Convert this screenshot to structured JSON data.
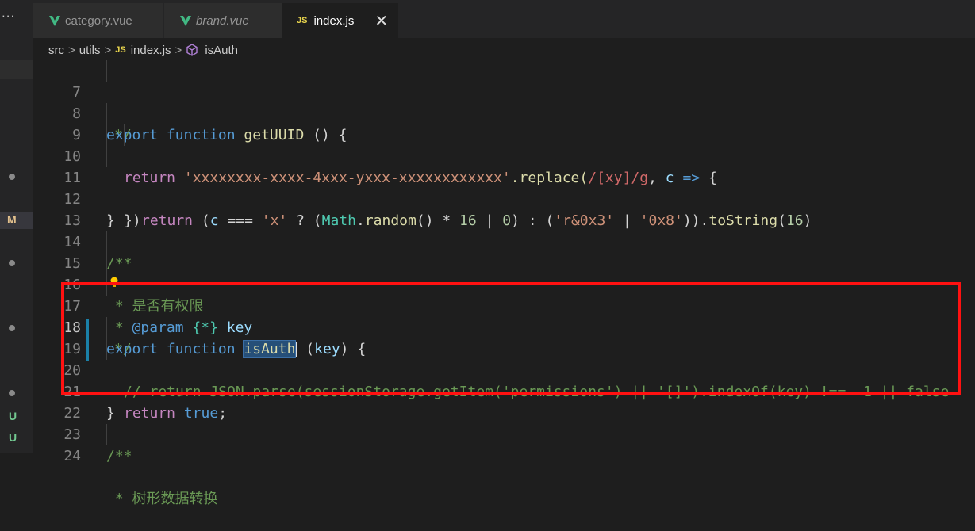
{
  "sidebar": {
    "more": "···",
    "markers": [
      {
        "text": "M",
        "color": "#e2c08d"
      },
      {
        "text": "U",
        "color": "#73c991"
      },
      {
        "text": "U",
        "color": "#73c991"
      }
    ]
  },
  "tabs": [
    {
      "label": "category.vue",
      "icon": "vue-icon",
      "active": false
    },
    {
      "label": "brand.vue",
      "icon": "vue-icon",
      "active": false
    },
    {
      "label": "index.js",
      "icon": "js-icon",
      "active": true
    }
  ],
  "tab_close": "✕",
  "js_badge": "JS",
  "breadcrumb": {
    "parts": [
      "src",
      "utils",
      "index.js",
      "isAuth"
    ],
    "sep": ">"
  },
  "code": {
    "l7": "*/",
    "l8_export": "export",
    "l8_function": "function",
    "l8_name": "getUUID",
    "l8_rest": " () {",
    "l9_return": "return",
    "l9_str": "'xxxxxxxx-xxxx-4xxx-yxxx-xxxxxxxxxxxx'",
    "l9_replace": ".replace(",
    "l9_regex": "/[xy]/g",
    "l9_comma": ", ",
    "l9_c": "c",
    "l9_arrow": "=>",
    "l9_end": " {",
    "l10_return": "return",
    "l10_p1": " (",
    "l10_c": "c",
    "l10_op": " === ",
    "l10_x": "'x'",
    "l10_q": " ? (",
    "l10_math": "Math",
    "l10_dot": ".",
    "l10_random": "random",
    "l10_p2": "() * ",
    "l10_16a": "16",
    "l10_or": " | ",
    "l10_0": "0",
    "l10_p3": ") : (",
    "l10_r": "'r&0x3'",
    "l10_or2": " | ",
    "l10_08": "'0x8'",
    "l10_p4": ")).",
    "l10_tostring": "toString",
    "l10_p5": "(",
    "l10_16b": "16",
    "l10_p6": ")",
    "l11": "})",
    "l12": "}",
    "l14": "/**",
    "l15": " * 是否有权限",
    "l16_star": " * ",
    "l16_param": "@param",
    "l16_type": "{*}",
    "l16_key": "key",
    "l17": "*/",
    "l18_export": "export",
    "l18_function": "function",
    "l18_name": "isAuth",
    "l18_p1": " (",
    "l18_key": "key",
    "l18_p2": ") {",
    "l19": "// return JSON.parse(sessionStorage.getItem('permissions') || '[]').indexOf(key) !== -1 || false",
    "l20_return": "return",
    "l20_true": "true",
    "l20_semi": ";",
    "l21": "}",
    "l23": "/**",
    "l24": " * 树形数据转换"
  },
  "line_numbers": [
    "7",
    "8",
    "9",
    "10",
    "11",
    "12",
    "13",
    "14",
    "15",
    "16",
    "17",
    "18",
    "19",
    "20",
    "21",
    "22",
    "23",
    "24"
  ]
}
